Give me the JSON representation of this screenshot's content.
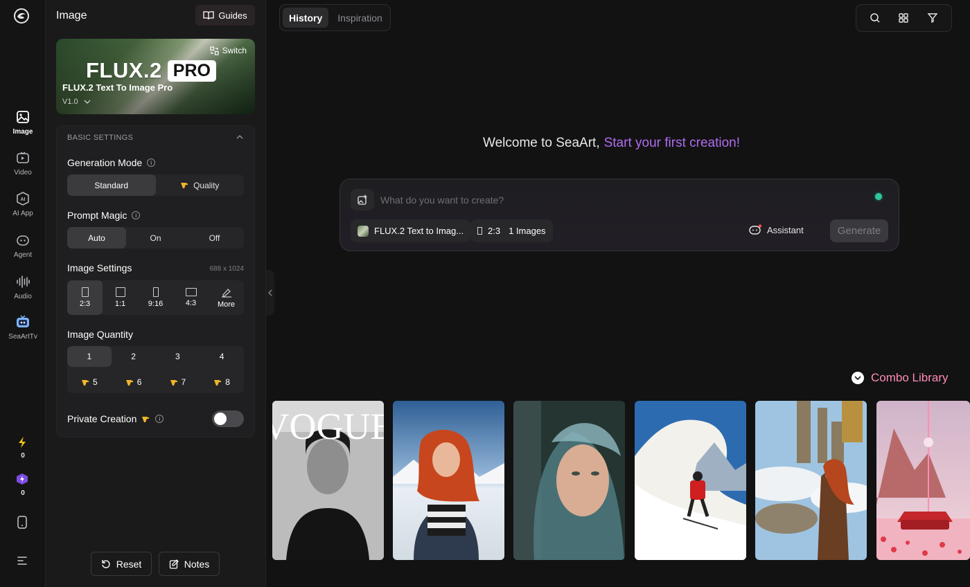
{
  "rail": {
    "items": [
      {
        "label": "Image",
        "icon": "image-icon"
      },
      {
        "label": "Video",
        "icon": "video-icon"
      },
      {
        "label": "AI App",
        "icon": "ai-app-icon"
      },
      {
        "label": "Agent",
        "icon": "agent-icon"
      },
      {
        "label": "Audio",
        "icon": "audio-icon"
      },
      {
        "label": "SeaArtTv",
        "icon": "seaarttv-icon"
      }
    ],
    "stamina": "0",
    "power": "0"
  },
  "panel": {
    "title": "Image",
    "guides_label": "Guides",
    "model": {
      "logo_word": "FLUX.2",
      "logo_badge": "PRO",
      "switch_label": "Switch",
      "name": "FLUX.2 Text To Image Pro",
      "version": "V1.0"
    },
    "basic_settings": {
      "heading": "BASIC SETTINGS",
      "generation_mode": {
        "label": "Generation Mode",
        "options": [
          "Standard",
          "Quality"
        ],
        "selected": "Standard"
      },
      "prompt_magic": {
        "label": "Prompt Magic",
        "options": [
          "Auto",
          "On",
          "Off"
        ],
        "selected": "Auto"
      },
      "image_settings": {
        "label": "Image Settings",
        "dimensions": "688 x 1024",
        "ratios": [
          "2:3",
          "1:1",
          "9:16",
          "4:3",
          "More"
        ],
        "selected": "2:3"
      },
      "image_quantity": {
        "label": "Image Quantity",
        "row1": [
          "1",
          "2",
          "3",
          "4"
        ],
        "row2": [
          "5",
          "6",
          "7",
          "8"
        ],
        "selected": "1"
      },
      "private_creation": {
        "label": "Private Creation",
        "enabled": false
      }
    },
    "reset_label": "Reset",
    "notes_label": "Notes"
  },
  "main": {
    "tabs": [
      "History",
      "Inspiration"
    ],
    "active_tab": "History",
    "welcome": "Welcome to SeaArt,",
    "welcome_highlight": "Start your first creation!",
    "prompt": {
      "placeholder": "What do you want to create?",
      "model_chip": "FLUX.2 Text to Imag...",
      "ratio_chip": "2:3",
      "count_chip": "1 Images",
      "assistant_label": "Assistant",
      "generate_label": "Generate"
    },
    "combo_label": "Combo Library",
    "gallery_overlay_text": "VOGUE"
  },
  "colors": {
    "accent_purple": "#b06df0",
    "combo_pink": "#ff8bb8",
    "online_dot": "#2fc7a0"
  }
}
